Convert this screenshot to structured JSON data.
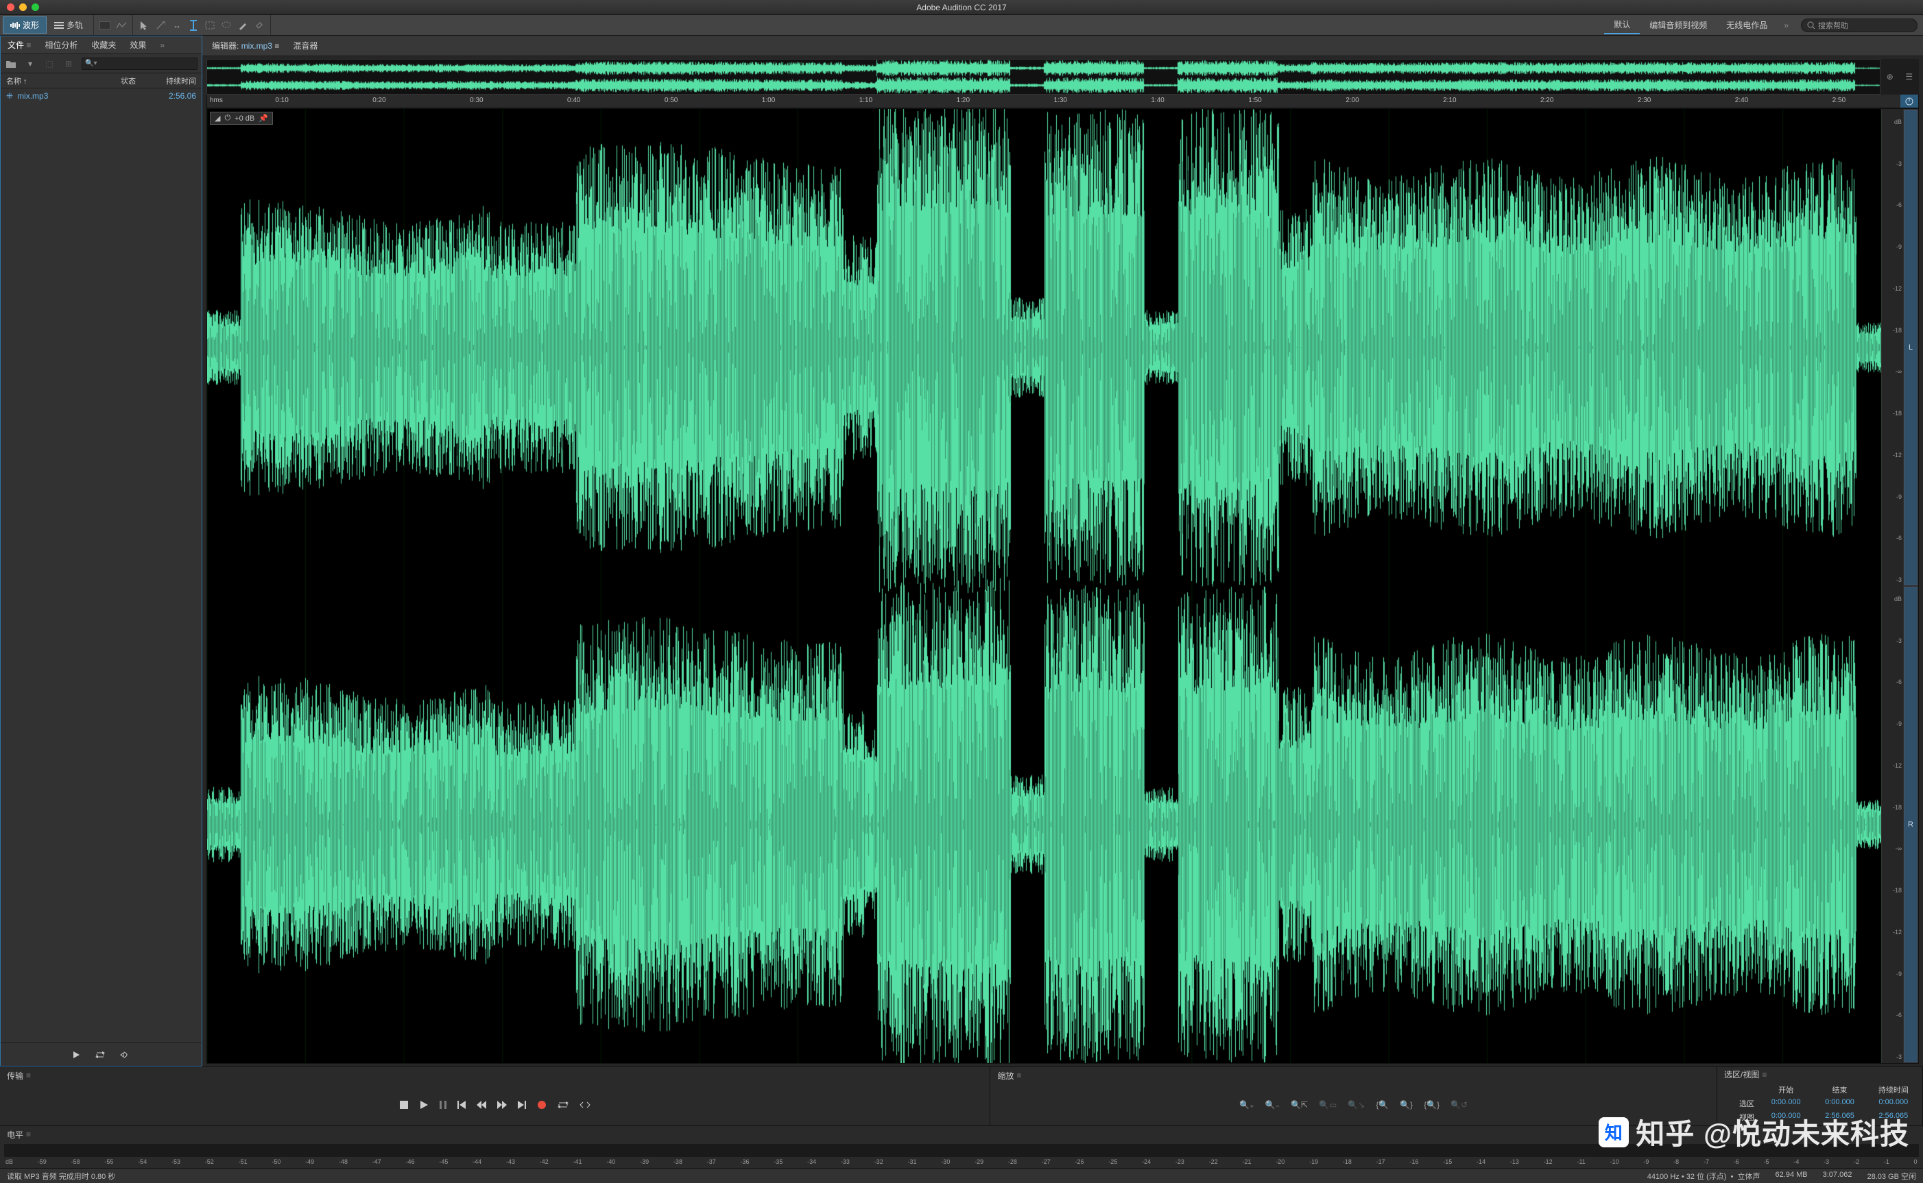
{
  "app": {
    "title": "Adobe Audition CC 2017"
  },
  "viewmode": {
    "waveform": "波形",
    "multitrack": "多轨"
  },
  "workspaces": {
    "default_": "默认",
    "editAudioToVideo": "编辑音频到视频",
    "radioProduction": "无线电作品"
  },
  "search": {
    "placeholder": "搜索帮助"
  },
  "leftPanel": {
    "tabs": {
      "files": "文件",
      "phase": "相位分析",
      "favorites": "收藏夹",
      "effects": "效果"
    },
    "columns": {
      "name": "名称 ↑",
      "status": "状态",
      "duration": "持续时间"
    },
    "file": {
      "name": "mix.mp3",
      "duration": "2:56.06"
    }
  },
  "editor": {
    "tab_prefix": "编辑器:",
    "filename": "mix.mp3",
    "mixer": "混音器",
    "hud_gain": "+0 dB",
    "timeline": {
      "unit": "hms",
      "ticks": [
        "0:10",
        "0:20",
        "0:30",
        "0:40",
        "0:50",
        "1:00",
        "1:10",
        "1:20",
        "1:30",
        "1:40",
        "1:50",
        "2:00",
        "2:10",
        "2:20",
        "2:30",
        "2:40",
        "2:50"
      ]
    },
    "db_ticks": [
      "dB",
      "-3",
      "-6",
      "-9",
      "-12",
      "-18",
      "-∞",
      "-18",
      "-12",
      "-9",
      "-6",
      "-3"
    ],
    "channels": {
      "left": "L",
      "right": "R"
    }
  },
  "bottom": {
    "transport_title": "传输",
    "zoom_title": "缩放",
    "selection_title": "选区/视图",
    "sel_headers": {
      "start": "开始",
      "end": "结束",
      "duration": "持续时间"
    },
    "sel_rows": {
      "selection": {
        "label": "选区",
        "start": "0:00.000",
        "end": "0:00.000",
        "dur": "0:00.000"
      },
      "view": {
        "label": "视图",
        "start": "0:00.000",
        "end": "2:56.065",
        "dur": "2:56.065"
      }
    },
    "levels_title": "电平",
    "db_scale": [
      "dB",
      "-59",
      "-58",
      "-55",
      "-54",
      "-53",
      "-52",
      "-51",
      "-50",
      "-49",
      "-48",
      "-47",
      "-46",
      "-45",
      "-44",
      "-43",
      "-42",
      "-41",
      "-40",
      "-39",
      "-38",
      "-37",
      "-36",
      "-35",
      "-34",
      "-33",
      "-32",
      "-31",
      "-30",
      "-29",
      "-28",
      "-27",
      "-26",
      "-25",
      "-24",
      "-23",
      "-22",
      "-21",
      "-20",
      "-19",
      "-18",
      "-17",
      "-16",
      "-15",
      "-14",
      "-13",
      "-12",
      "-11",
      "-10",
      "-9",
      "-8",
      "-7",
      "-6",
      "-5",
      "-4",
      "-3",
      "-2",
      "-1",
      "0"
    ]
  },
  "status": {
    "task": "读取 MP3 音频 完成用时 0.80 秒",
    "sample_rate": "44100 Hz",
    "bit_depth": "32 位 (浮点)",
    "channels": "立体声",
    "size": "62.94 MB",
    "total": "3:07.062",
    "disk": "28.03 GB 空闲"
  },
  "watermark": {
    "logo": "知",
    "text": "知乎 @悦动未来科技"
  }
}
